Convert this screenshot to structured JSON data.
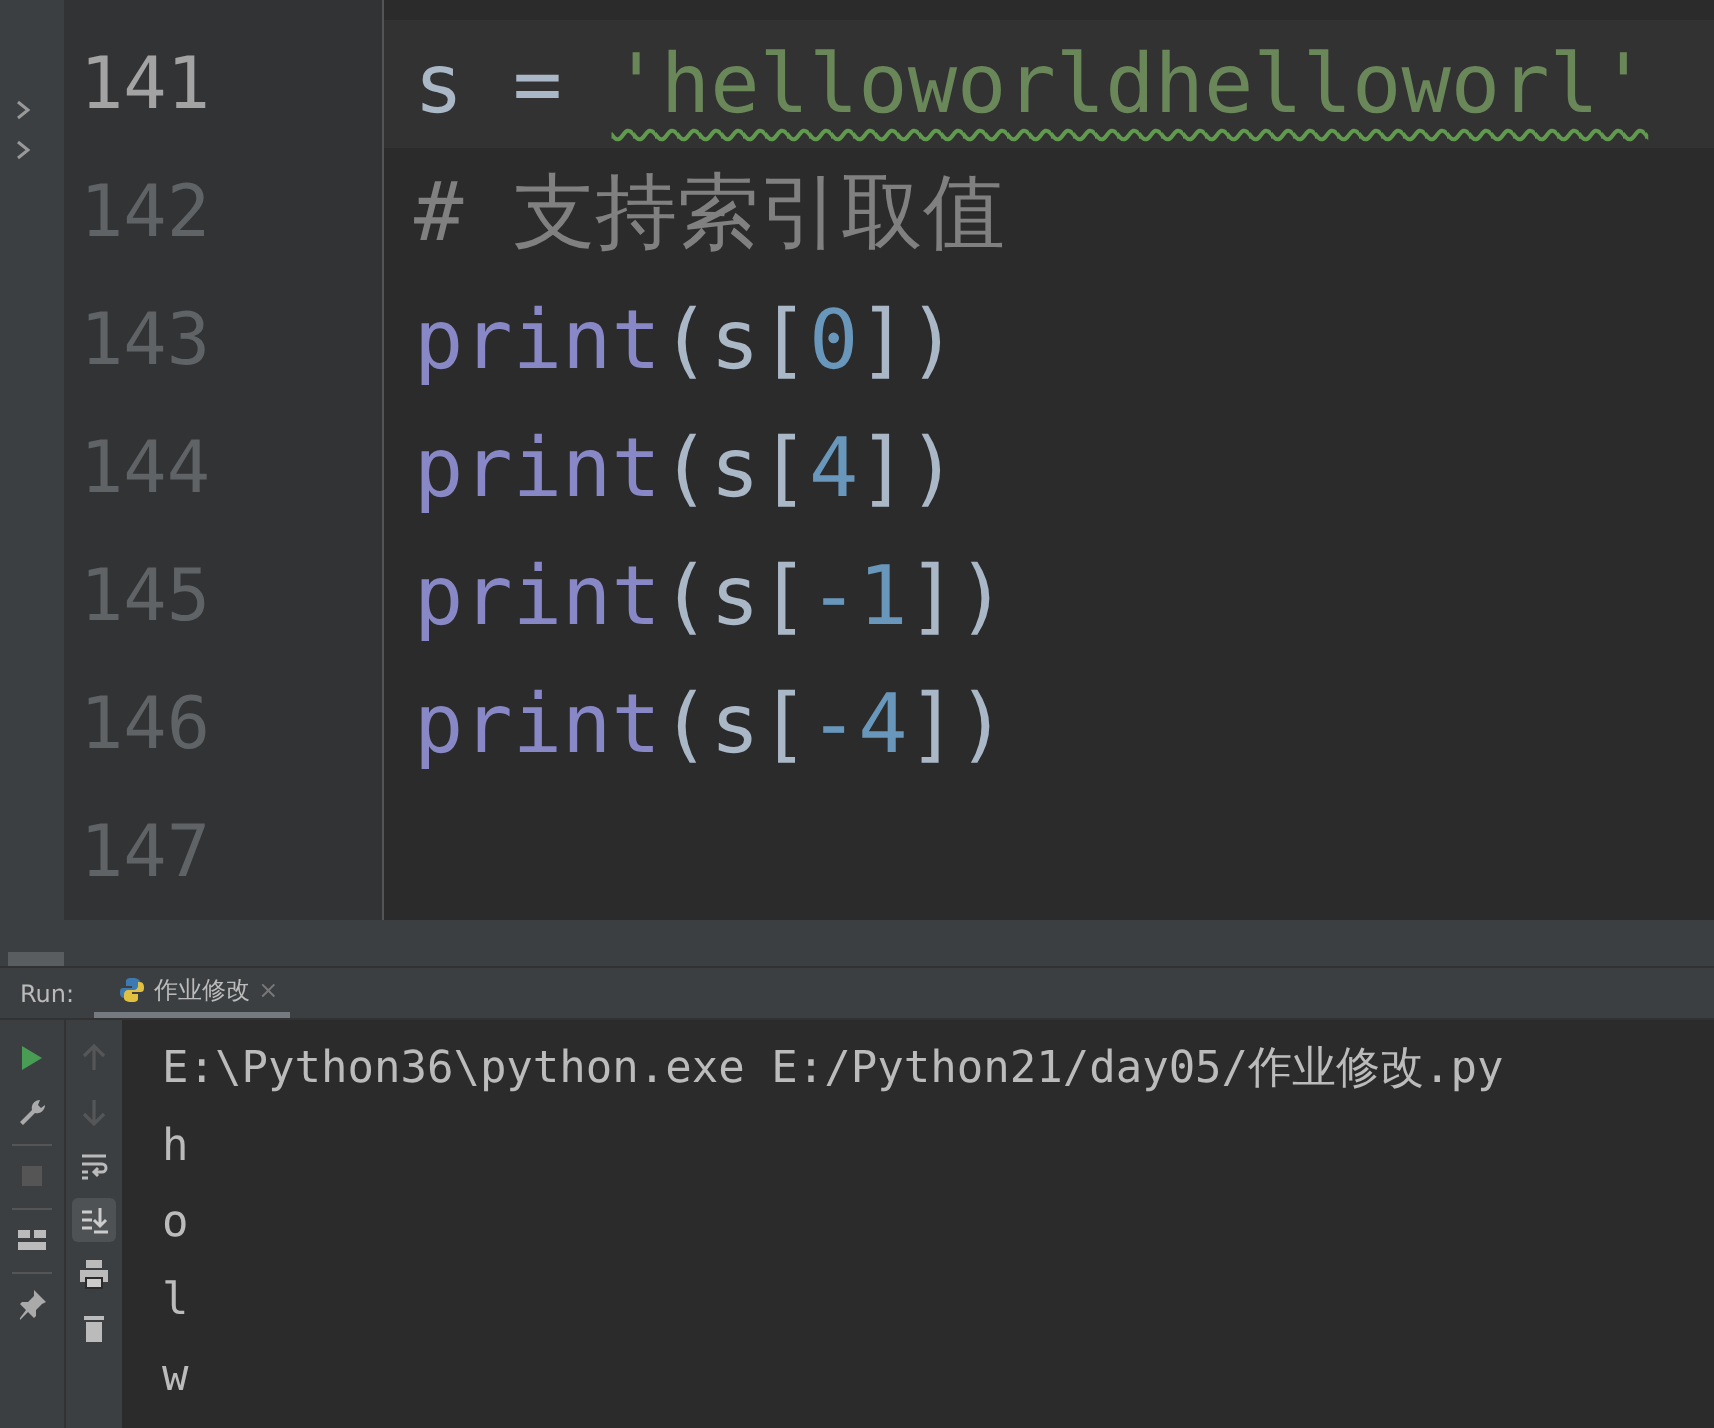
{
  "editor": {
    "lines": [
      {
        "number": "141",
        "current": true,
        "tokens": [
          {
            "kind": "ident",
            "text": "s"
          },
          {
            "kind": "op",
            "text": " = "
          },
          {
            "kind": "string",
            "text": "'helloworldhelloworl'",
            "warning": true
          }
        ]
      },
      {
        "number": "142",
        "current": false,
        "tokens": [
          {
            "kind": "comment",
            "text": "# 支持索引取值"
          }
        ]
      },
      {
        "number": "143",
        "current": false,
        "tokens": [
          {
            "kind": "builtin",
            "text": "print"
          },
          {
            "kind": "ident",
            "text": "(s["
          },
          {
            "kind": "number",
            "text": "0"
          },
          {
            "kind": "ident",
            "text": "])"
          }
        ]
      },
      {
        "number": "144",
        "current": false,
        "tokens": [
          {
            "kind": "builtin",
            "text": "print"
          },
          {
            "kind": "ident",
            "text": "(s["
          },
          {
            "kind": "number",
            "text": "4"
          },
          {
            "kind": "ident",
            "text": "])"
          }
        ]
      },
      {
        "number": "145",
        "current": false,
        "tokens": [
          {
            "kind": "builtin",
            "text": "print"
          },
          {
            "kind": "ident",
            "text": "(s["
          },
          {
            "kind": "number",
            "text": "-1"
          },
          {
            "kind": "ident",
            "text": "])"
          }
        ]
      },
      {
        "number": "146",
        "current": false,
        "tokens": [
          {
            "kind": "builtin",
            "text": "print"
          },
          {
            "kind": "ident",
            "text": "(s["
          },
          {
            "kind": "number",
            "text": "-4"
          },
          {
            "kind": "ident",
            "text": "])"
          }
        ]
      },
      {
        "number": "147",
        "current": false
      }
    ]
  },
  "run_panel": {
    "label": "Run:",
    "tabs": [
      {
        "title": "作业修改",
        "close": "×",
        "selected": true
      }
    ],
    "main_tools": [
      {
        "kind": "run"
      },
      {
        "kind": "wrench"
      },
      {
        "kind": "stop"
      },
      {
        "kind": "layout"
      },
      {
        "kind": "pin"
      }
    ],
    "console_tools": [
      {
        "kind": "up",
        "disabled": true
      },
      {
        "kind": "down",
        "disabled": true
      },
      {
        "kind": "wrap",
        "disabled": false
      },
      {
        "kind": "scroll-end",
        "disabled": false,
        "on": true
      },
      {
        "kind": "print",
        "disabled": false
      },
      {
        "kind": "trash",
        "disabled": false
      }
    ],
    "console_lines": [
      "E:\\Python36\\python.exe E:/Python21/day05/作业修改.py",
      "h",
      "o",
      "l",
      "w"
    ]
  }
}
